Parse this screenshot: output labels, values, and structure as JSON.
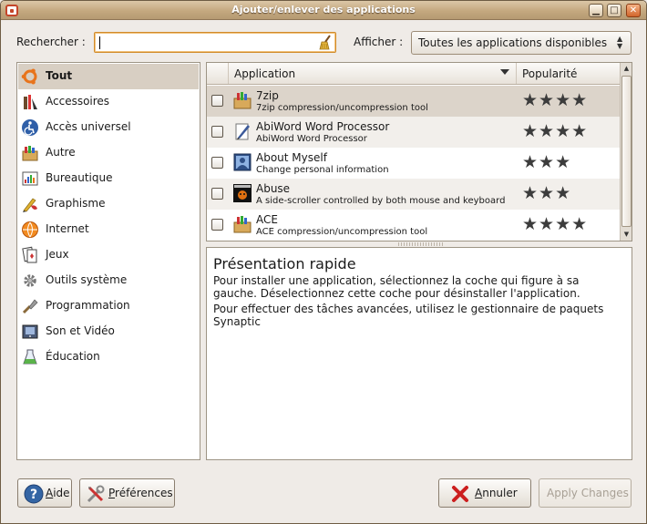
{
  "window": {
    "title": "Ajouter/enlever des applications"
  },
  "search": {
    "label": "Rechercher :",
    "value": ""
  },
  "show": {
    "label": "Afficher :",
    "selected": "Toutes les applications disponibles"
  },
  "categories": [
    {
      "label": "Tout",
      "icon": "ubuntu-logo-icon"
    },
    {
      "label": "Accessoires",
      "icon": "accessories-icon"
    },
    {
      "label": "Accès universel",
      "icon": "accessibility-icon"
    },
    {
      "label": "Autre",
      "icon": "other-icon"
    },
    {
      "label": "Bureautique",
      "icon": "office-icon"
    },
    {
      "label": "Graphisme",
      "icon": "graphics-icon"
    },
    {
      "label": "Internet",
      "icon": "internet-icon"
    },
    {
      "label": "Jeux",
      "icon": "games-icon"
    },
    {
      "label": "Outils système",
      "icon": "system-tools-icon"
    },
    {
      "label": "Programmation",
      "icon": "programming-icon"
    },
    {
      "label": "Son et Vidéo",
      "icon": "sound-video-icon"
    },
    {
      "label": "Éducation",
      "icon": "education-icon"
    }
  ],
  "list": {
    "col_application": "Application",
    "col_popularity": "Popularité",
    "rows": [
      {
        "name": "7zip",
        "desc": "7zip compression/uncompression tool",
        "stars": "★★★★",
        "rating": 4
      },
      {
        "name": "AbiWord Word Processor",
        "desc": "AbiWord Word Processor",
        "stars": "★★★★",
        "rating": 4
      },
      {
        "name": "About Myself",
        "desc": "Change personal information",
        "stars": "★★★",
        "rating": 3
      },
      {
        "name": "Abuse",
        "desc": "A side-scroller controlled by both mouse and keyboard",
        "stars": "★★★",
        "rating": 3
      },
      {
        "name": "ACE",
        "desc": "ACE compression/uncompression tool",
        "stars": "★★★★",
        "rating": 4
      }
    ]
  },
  "description": {
    "title": "Présentation rapide",
    "p1": "Pour installer une application, sélectionnez la coche qui figure à sa gauche. Déselectionnez cette coche pour désinstaller l'application.",
    "p2": "Pour effectuer des tâches avancées, utilisez le gestionnaire de paquets Synaptic"
  },
  "buttons": {
    "help_u": "A",
    "help_rest": "ide",
    "prefs_u": "P",
    "prefs_rest": "références",
    "cancel_u": "A",
    "cancel_rest": "nnuler",
    "apply": "Apply Changes"
  },
  "colors": {
    "titlebar": "#c4a87f",
    "selection": "#d8cfc3",
    "focus": "#d18b2a",
    "accent": "#e8741c"
  }
}
